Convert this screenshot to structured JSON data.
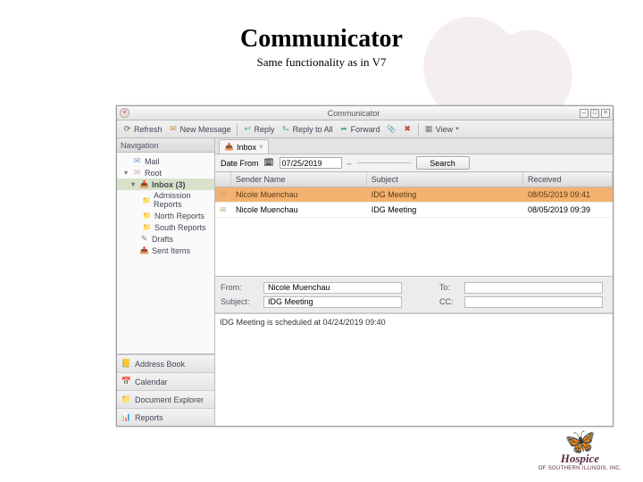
{
  "slide": {
    "title": "Communicator",
    "subtitle": "Same functionality as in V7"
  },
  "app": {
    "title": "Communicator"
  },
  "toolbar": {
    "refresh": "Refresh",
    "newmsg": "New Message",
    "reply": "Reply",
    "replyall": "Reply to All",
    "forward": "Forward",
    "view": "View"
  },
  "sidebar": {
    "header": "Navigation",
    "mail": "Mail",
    "root": "Root",
    "inbox": "Inbox (3)",
    "admission": "Admission Reports",
    "north": "North Reports",
    "south": "South Reports",
    "drafts": "Drafts",
    "sent": "Sent Items",
    "bottom": {
      "ab": "Address Book",
      "cal": "Calendar",
      "doc": "Document Explorer",
      "rep": "Reports"
    }
  },
  "tab": {
    "label": "Inbox"
  },
  "filter": {
    "label": "Date From",
    "value": "07/25/2019",
    "to": "–",
    "search": "Search"
  },
  "columns": {
    "sender": "Sender Name",
    "subject": "Subject",
    "received": "Received"
  },
  "rows": [
    {
      "sender": "Nicole Muenchau",
      "subject": "IDG Meeting",
      "received": "08/05/2019 09:41"
    },
    {
      "sender": "Nicole Muenchau",
      "subject": "IDG Meeting",
      "received": "08/05/2019 09:39"
    }
  ],
  "preview": {
    "from_lbl": "From:",
    "from": "Nicole Muenchau",
    "to_lbl": "To:",
    "to": "",
    "subj_lbl": "Subject:",
    "subj": "IDG Meeting",
    "cc_lbl": "CC:",
    "cc": "",
    "body": "IDG Meeting is scheduled at 04/24/2019 09:40"
  },
  "logo": {
    "name": "Hospice",
    "sub": "OF SOUTHERN ILLINOIS, INC."
  }
}
